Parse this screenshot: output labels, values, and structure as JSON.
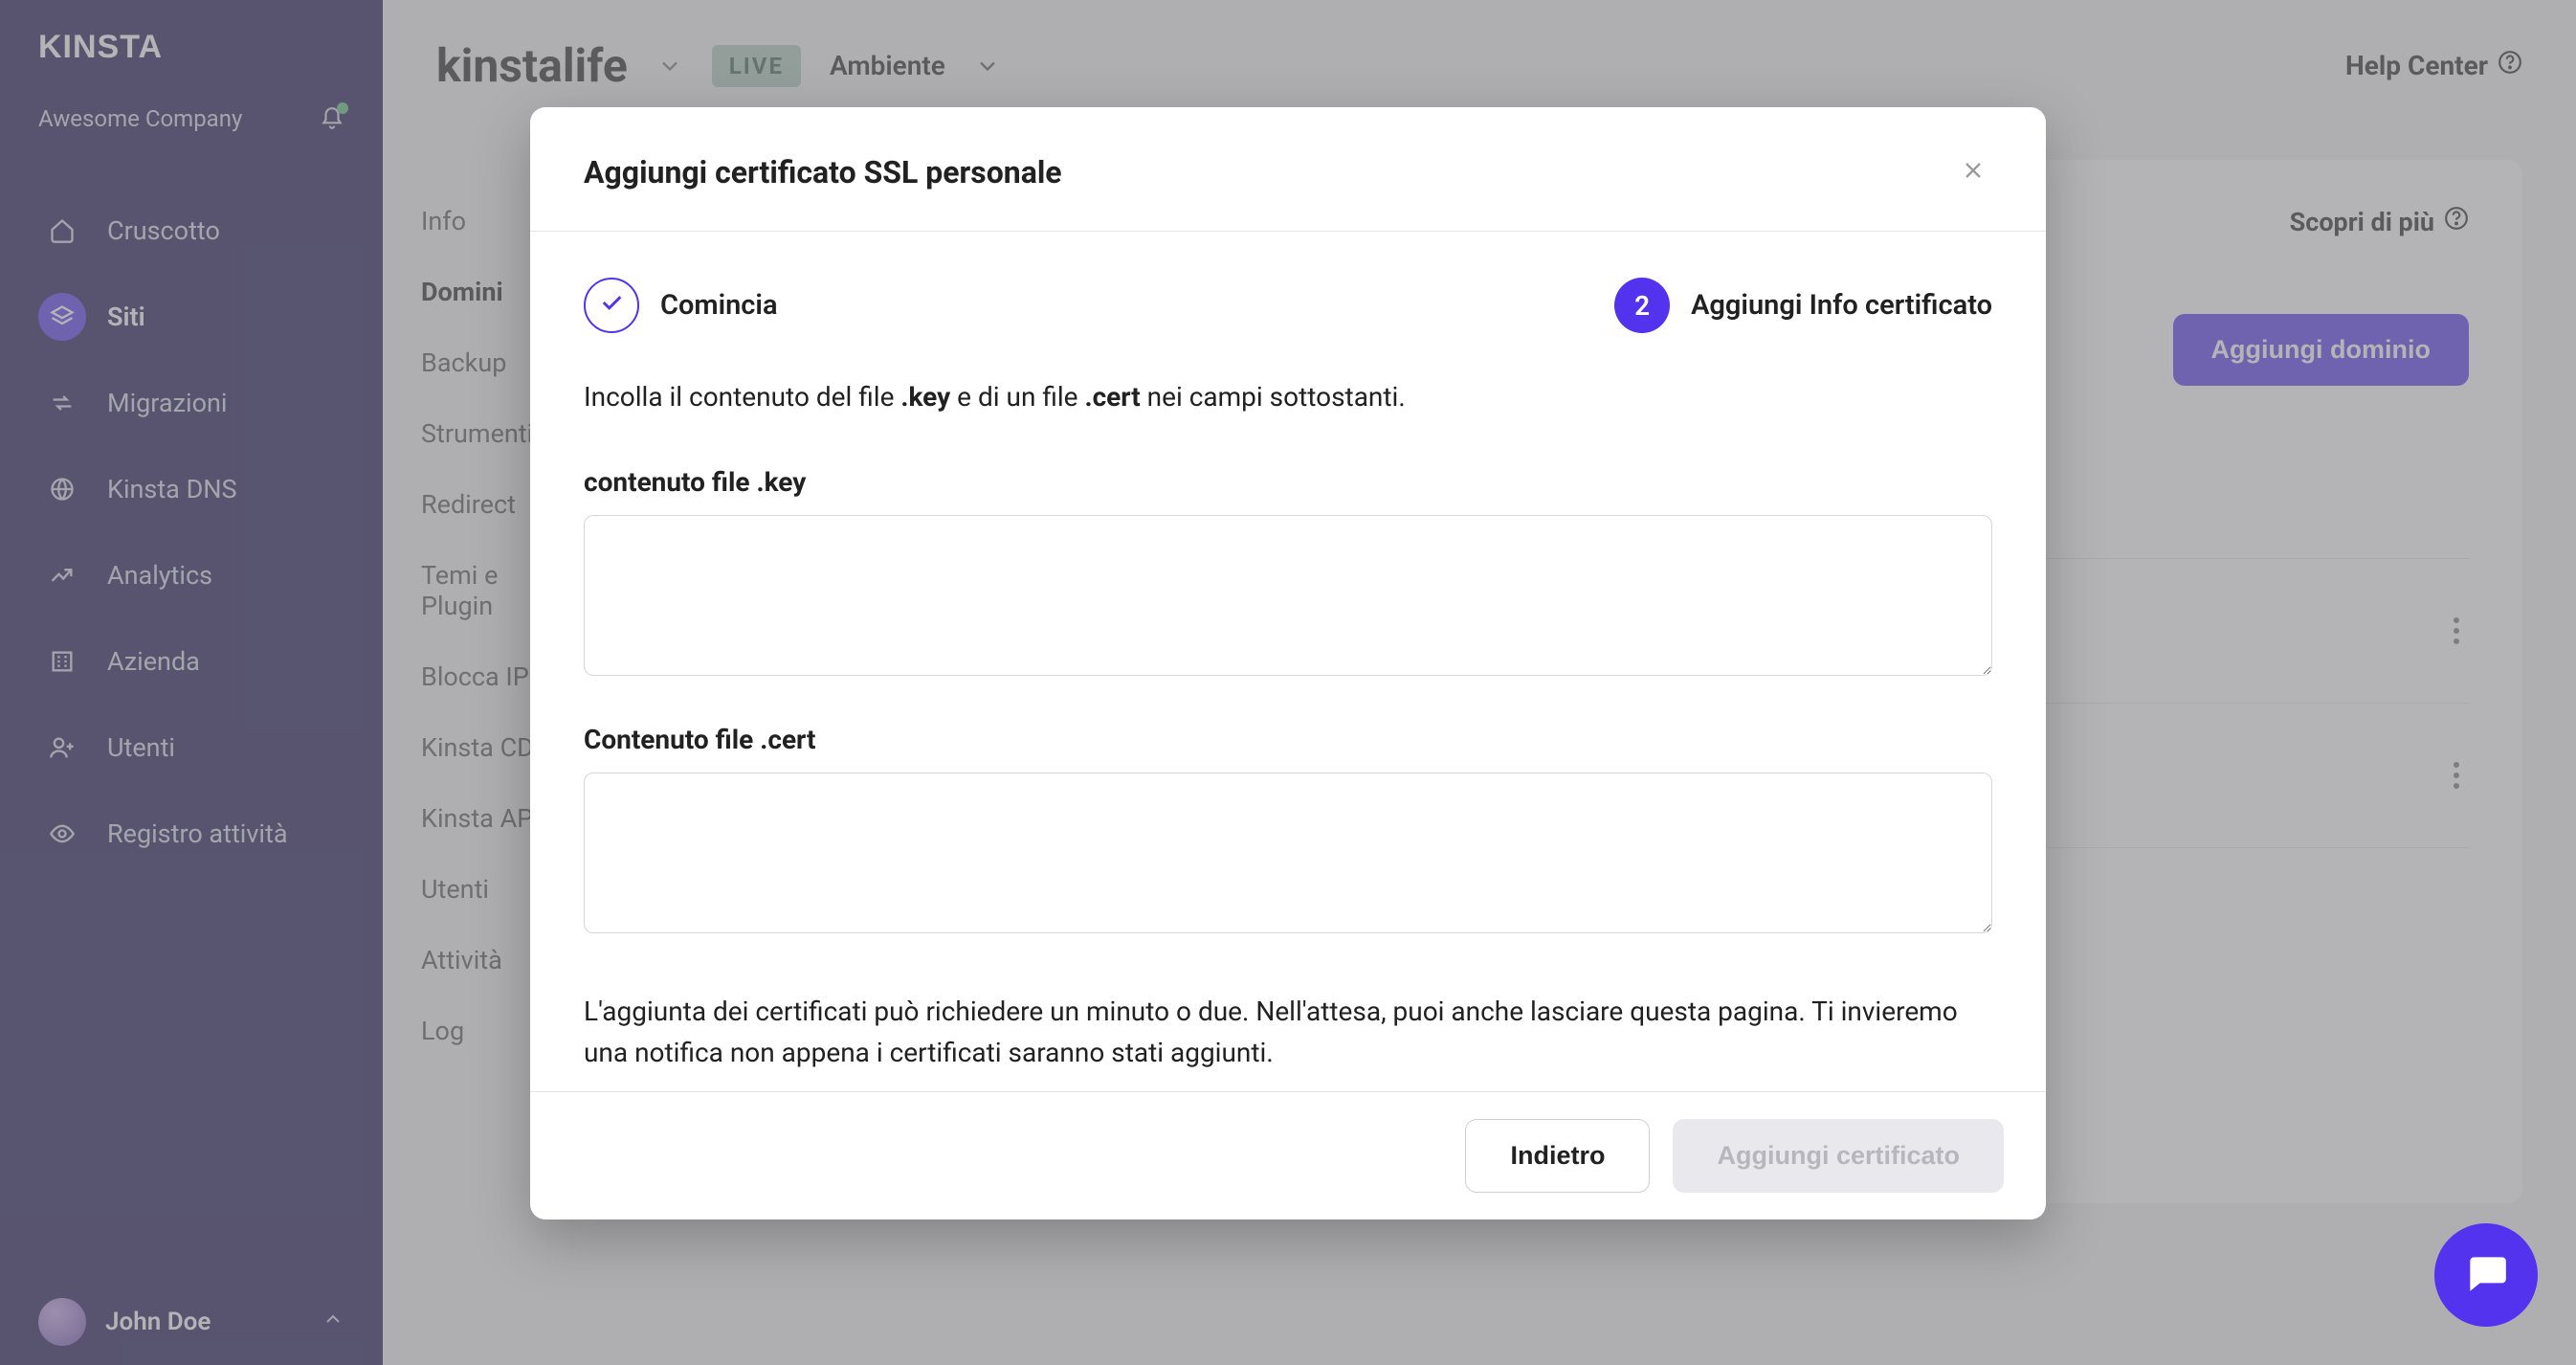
{
  "brand": "Kinsta",
  "company_name": "Awesome Company",
  "sidebar": {
    "items": [
      {
        "label": "Cruscotto",
        "icon": "home-icon"
      },
      {
        "label": "Siti",
        "icon": "layers-icon"
      },
      {
        "label": "Migrazioni",
        "icon": "arrows-icon"
      },
      {
        "label": "Kinsta DNS",
        "icon": "globe-icon"
      },
      {
        "label": "Analytics",
        "icon": "trend-icon"
      },
      {
        "label": "Azienda",
        "icon": "building-icon"
      },
      {
        "label": "Utenti",
        "icon": "user-plus-icon"
      },
      {
        "label": "Registro attività",
        "icon": "eye-icon"
      }
    ],
    "active_index": 1
  },
  "user": {
    "name": "John Doe"
  },
  "topbar": {
    "site_name": "kinstalife",
    "env_badge": "LIVE",
    "env_label": "Ambiente",
    "help_center": "Help Center"
  },
  "subnav": {
    "items": [
      "Info",
      "Domini",
      "Backup",
      "Strumenti",
      "Redirect",
      "Temi e Plugin",
      "Blocca IP",
      "Kinsta CDN",
      "Kinsta APM",
      "Utenti",
      "Attività",
      "Log"
    ],
    "active_index": 1
  },
  "page": {
    "learn_more": "Scopri di più",
    "add_domain_button": "Aggiungi dominio"
  },
  "modal": {
    "title": "Aggiungi certificato SSL personale",
    "step1_label": "Comincia",
    "step2_number": "2",
    "step2_label": "Aggiungi Info certificato",
    "intro_pre": "Incolla il contenuto del file ",
    "intro_key": ".key",
    "intro_mid": " e di un file ",
    "intro_cert": ".cert",
    "intro_post": " nei campi sottostanti.",
    "key_field_label": "contenuto file .key",
    "cert_field_label": "Contenuto file .cert",
    "note": "L'aggiunta dei certificati può richiedere un minuto o due. Nell'attesa, puoi anche lasciare questa pagina. Ti invieremo una notifica non appena i certificati saranno stati aggiunti.",
    "back_btn": "Indietro",
    "submit_btn": "Aggiungi certificato"
  },
  "colors": {
    "accent": "#5333ed",
    "sidebar_bg": "#1a1151"
  }
}
